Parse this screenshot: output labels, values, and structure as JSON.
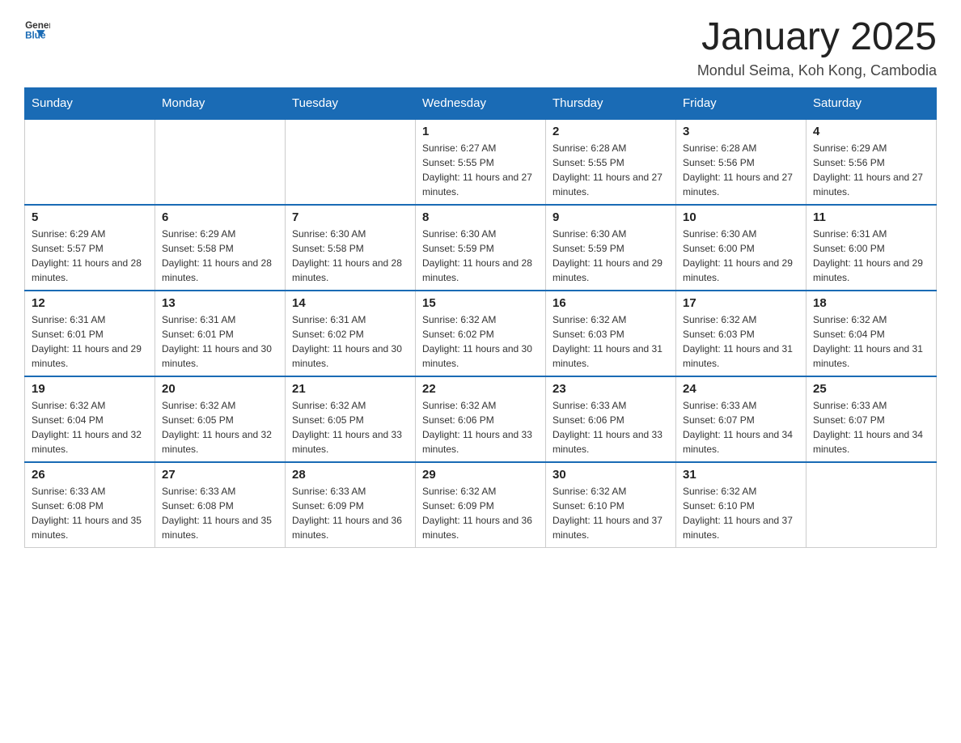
{
  "header": {
    "logo_general": "General",
    "logo_blue": "Blue",
    "month_title": "January 2025",
    "location": "Mondul Seima, Koh Kong, Cambodia"
  },
  "days_of_week": [
    "Sunday",
    "Monday",
    "Tuesday",
    "Wednesday",
    "Thursday",
    "Friday",
    "Saturday"
  ],
  "weeks": [
    [
      {
        "day": "",
        "info": ""
      },
      {
        "day": "",
        "info": ""
      },
      {
        "day": "",
        "info": ""
      },
      {
        "day": "1",
        "info": "Sunrise: 6:27 AM\nSunset: 5:55 PM\nDaylight: 11 hours and 27 minutes."
      },
      {
        "day": "2",
        "info": "Sunrise: 6:28 AM\nSunset: 5:55 PM\nDaylight: 11 hours and 27 minutes."
      },
      {
        "day": "3",
        "info": "Sunrise: 6:28 AM\nSunset: 5:56 PM\nDaylight: 11 hours and 27 minutes."
      },
      {
        "day": "4",
        "info": "Sunrise: 6:29 AM\nSunset: 5:56 PM\nDaylight: 11 hours and 27 minutes."
      }
    ],
    [
      {
        "day": "5",
        "info": "Sunrise: 6:29 AM\nSunset: 5:57 PM\nDaylight: 11 hours and 28 minutes."
      },
      {
        "day": "6",
        "info": "Sunrise: 6:29 AM\nSunset: 5:58 PM\nDaylight: 11 hours and 28 minutes."
      },
      {
        "day": "7",
        "info": "Sunrise: 6:30 AM\nSunset: 5:58 PM\nDaylight: 11 hours and 28 minutes."
      },
      {
        "day": "8",
        "info": "Sunrise: 6:30 AM\nSunset: 5:59 PM\nDaylight: 11 hours and 28 minutes."
      },
      {
        "day": "9",
        "info": "Sunrise: 6:30 AM\nSunset: 5:59 PM\nDaylight: 11 hours and 29 minutes."
      },
      {
        "day": "10",
        "info": "Sunrise: 6:30 AM\nSunset: 6:00 PM\nDaylight: 11 hours and 29 minutes."
      },
      {
        "day": "11",
        "info": "Sunrise: 6:31 AM\nSunset: 6:00 PM\nDaylight: 11 hours and 29 minutes."
      }
    ],
    [
      {
        "day": "12",
        "info": "Sunrise: 6:31 AM\nSunset: 6:01 PM\nDaylight: 11 hours and 29 minutes."
      },
      {
        "day": "13",
        "info": "Sunrise: 6:31 AM\nSunset: 6:01 PM\nDaylight: 11 hours and 30 minutes."
      },
      {
        "day": "14",
        "info": "Sunrise: 6:31 AM\nSunset: 6:02 PM\nDaylight: 11 hours and 30 minutes."
      },
      {
        "day": "15",
        "info": "Sunrise: 6:32 AM\nSunset: 6:02 PM\nDaylight: 11 hours and 30 minutes."
      },
      {
        "day": "16",
        "info": "Sunrise: 6:32 AM\nSunset: 6:03 PM\nDaylight: 11 hours and 31 minutes."
      },
      {
        "day": "17",
        "info": "Sunrise: 6:32 AM\nSunset: 6:03 PM\nDaylight: 11 hours and 31 minutes."
      },
      {
        "day": "18",
        "info": "Sunrise: 6:32 AM\nSunset: 6:04 PM\nDaylight: 11 hours and 31 minutes."
      }
    ],
    [
      {
        "day": "19",
        "info": "Sunrise: 6:32 AM\nSunset: 6:04 PM\nDaylight: 11 hours and 32 minutes."
      },
      {
        "day": "20",
        "info": "Sunrise: 6:32 AM\nSunset: 6:05 PM\nDaylight: 11 hours and 32 minutes."
      },
      {
        "day": "21",
        "info": "Sunrise: 6:32 AM\nSunset: 6:05 PM\nDaylight: 11 hours and 33 minutes."
      },
      {
        "day": "22",
        "info": "Sunrise: 6:32 AM\nSunset: 6:06 PM\nDaylight: 11 hours and 33 minutes."
      },
      {
        "day": "23",
        "info": "Sunrise: 6:33 AM\nSunset: 6:06 PM\nDaylight: 11 hours and 33 minutes."
      },
      {
        "day": "24",
        "info": "Sunrise: 6:33 AM\nSunset: 6:07 PM\nDaylight: 11 hours and 34 minutes."
      },
      {
        "day": "25",
        "info": "Sunrise: 6:33 AM\nSunset: 6:07 PM\nDaylight: 11 hours and 34 minutes."
      }
    ],
    [
      {
        "day": "26",
        "info": "Sunrise: 6:33 AM\nSunset: 6:08 PM\nDaylight: 11 hours and 35 minutes."
      },
      {
        "day": "27",
        "info": "Sunrise: 6:33 AM\nSunset: 6:08 PM\nDaylight: 11 hours and 35 minutes."
      },
      {
        "day": "28",
        "info": "Sunrise: 6:33 AM\nSunset: 6:09 PM\nDaylight: 11 hours and 36 minutes."
      },
      {
        "day": "29",
        "info": "Sunrise: 6:32 AM\nSunset: 6:09 PM\nDaylight: 11 hours and 36 minutes."
      },
      {
        "day": "30",
        "info": "Sunrise: 6:32 AM\nSunset: 6:10 PM\nDaylight: 11 hours and 37 minutes."
      },
      {
        "day": "31",
        "info": "Sunrise: 6:32 AM\nSunset: 6:10 PM\nDaylight: 11 hours and 37 minutes."
      },
      {
        "day": "",
        "info": ""
      }
    ]
  ]
}
